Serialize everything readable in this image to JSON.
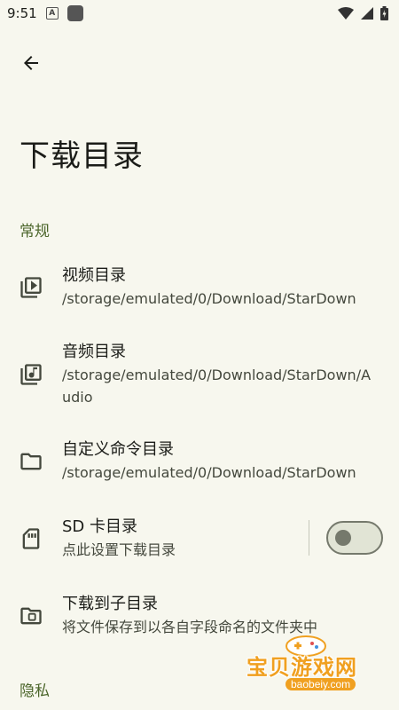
{
  "status_bar": {
    "time": "9:51",
    "notif_letter": "A"
  },
  "title": "下载目录",
  "sections": {
    "general": "常规",
    "privacy": "隐私"
  },
  "items": [
    {
      "title": "视频目录",
      "summary": "/storage/emulated/0/Download/StarDown"
    },
    {
      "title": "音频目录",
      "summary": "/storage/emulated/0/Download/StarDown/Audio"
    },
    {
      "title": "自定义命令目录",
      "summary": "/storage/emulated/0/Download/StarDown"
    },
    {
      "title": "SD 卡目录",
      "summary": "点此设置下载目录",
      "toggle_on": false
    },
    {
      "title": "下载到子目录",
      "summary": "将文件保存到以各自字段命名的文件夹中"
    }
  ],
  "watermark": {
    "text": "宝贝游戏网",
    "url": "baobeiy.com"
  },
  "colors": {
    "background": "#f7f7ee",
    "accent": "#4c662b",
    "text": "#1b1c18"
  }
}
